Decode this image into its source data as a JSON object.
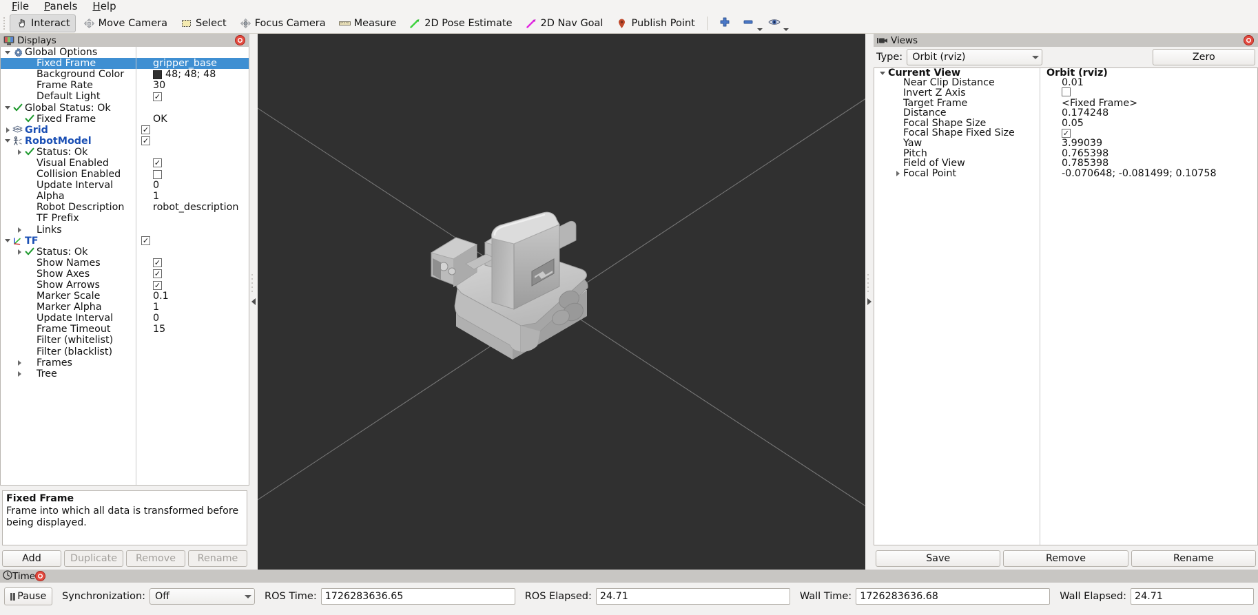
{
  "menubar": {
    "items": [
      "File",
      "Panels",
      "Help"
    ]
  },
  "toolbar": {
    "tools": [
      {
        "label": "Interact",
        "icon": "hand-cursor-icon",
        "checked": true
      },
      {
        "label": "Move Camera",
        "icon": "move-camera-icon",
        "checked": false
      },
      {
        "label": "Select",
        "icon": "select-rectangle-icon",
        "checked": false
      },
      {
        "label": "Focus Camera",
        "icon": "focus-camera-icon",
        "checked": false
      },
      {
        "label": "Measure",
        "icon": "ruler-icon",
        "checked": false
      },
      {
        "label": "2D Pose Estimate",
        "icon": "green-arrow-icon",
        "checked": false
      },
      {
        "label": "2D Nav Goal",
        "icon": "magenta-arrow-icon",
        "checked": false
      },
      {
        "label": "Publish Point",
        "icon": "map-pin-icon",
        "checked": false
      }
    ],
    "icon_buttons": [
      {
        "name": "add-tool-button",
        "icon": "plus-icon"
      },
      {
        "name": "remove-tool-button",
        "icon": "minus-icon"
      },
      {
        "name": "visibility-button",
        "icon": "eye-icon"
      }
    ]
  },
  "displays": {
    "title": "Displays",
    "close_icon": "close-icon",
    "panel_icon": "display-monitor-icon",
    "rows": [
      {
        "indent": 0,
        "arrow": "down",
        "icon": "gear-icon",
        "label": "Global Options",
        "style": "plain",
        "value_type": "none",
        "value": ""
      },
      {
        "indent": 1,
        "arrow": "none",
        "icon": "none",
        "label": "Fixed Frame",
        "style": "plain",
        "value_type": "text",
        "value": "gripper_base",
        "selected": true
      },
      {
        "indent": 1,
        "arrow": "none",
        "icon": "none",
        "label": "Background Color",
        "style": "plain",
        "value_type": "color",
        "value": "48; 48; 48",
        "color": "#303030"
      },
      {
        "indent": 1,
        "arrow": "none",
        "icon": "none",
        "label": "Frame Rate",
        "style": "plain",
        "value_type": "text",
        "value": "30"
      },
      {
        "indent": 1,
        "arrow": "none",
        "icon": "none",
        "label": "Default Light",
        "style": "plain",
        "value_type": "checked",
        "value": ""
      },
      {
        "indent": 0,
        "arrow": "down",
        "icon": "check-icon",
        "label": "Global Status: Ok",
        "style": "plain",
        "value_type": "none",
        "value": ""
      },
      {
        "indent": 1,
        "arrow": "none",
        "icon": "check-icon",
        "label": "Fixed Frame",
        "style": "plain",
        "value_type": "text",
        "value": "OK"
      },
      {
        "indent": 0,
        "arrow": "right",
        "icon": "grid-icon",
        "label": "Grid",
        "style": "blue",
        "value_type": "checked",
        "value": ""
      },
      {
        "indent": 0,
        "arrow": "down",
        "icon": "robot-icon",
        "label": "RobotModel",
        "style": "blue",
        "value_type": "checked",
        "value": ""
      },
      {
        "indent": 1,
        "arrow": "right",
        "icon": "check-icon",
        "label": "Status: Ok",
        "style": "plain",
        "value_type": "none",
        "value": ""
      },
      {
        "indent": 1,
        "arrow": "none",
        "icon": "none",
        "label": "Visual Enabled",
        "style": "plain",
        "value_type": "checked",
        "value": ""
      },
      {
        "indent": 1,
        "arrow": "none",
        "icon": "none",
        "label": "Collision Enabled",
        "style": "plain",
        "value_type": "unchecked",
        "value": ""
      },
      {
        "indent": 1,
        "arrow": "none",
        "icon": "none",
        "label": "Update Interval",
        "style": "plain",
        "value_type": "text",
        "value": "0"
      },
      {
        "indent": 1,
        "arrow": "none",
        "icon": "none",
        "label": "Alpha",
        "style": "plain",
        "value_type": "text",
        "value": "1"
      },
      {
        "indent": 1,
        "arrow": "none",
        "icon": "none",
        "label": "Robot Description",
        "style": "plain",
        "value_type": "text",
        "value": "robot_description"
      },
      {
        "indent": 1,
        "arrow": "none",
        "icon": "none",
        "label": "TF Prefix",
        "style": "plain",
        "value_type": "text",
        "value": ""
      },
      {
        "indent": 1,
        "arrow": "right",
        "icon": "none",
        "label": "Links",
        "style": "plain",
        "value_type": "none",
        "value": ""
      },
      {
        "indent": 0,
        "arrow": "down",
        "icon": "tf-axes-icon",
        "label": "TF",
        "style": "blue",
        "value_type": "checked",
        "value": ""
      },
      {
        "indent": 1,
        "arrow": "right",
        "icon": "check-icon",
        "label": "Status: Ok",
        "style": "plain",
        "value_type": "none",
        "value": ""
      },
      {
        "indent": 1,
        "arrow": "none",
        "icon": "none",
        "label": "Show Names",
        "style": "plain",
        "value_type": "checked",
        "value": ""
      },
      {
        "indent": 1,
        "arrow": "none",
        "icon": "none",
        "label": "Show Axes",
        "style": "plain",
        "value_type": "checked",
        "value": ""
      },
      {
        "indent": 1,
        "arrow": "none",
        "icon": "none",
        "label": "Show Arrows",
        "style": "plain",
        "value_type": "checked",
        "value": ""
      },
      {
        "indent": 1,
        "arrow": "none",
        "icon": "none",
        "label": "Marker Scale",
        "style": "plain",
        "value_type": "text",
        "value": "0.1"
      },
      {
        "indent": 1,
        "arrow": "none",
        "icon": "none",
        "label": "Marker Alpha",
        "style": "plain",
        "value_type": "text",
        "value": "1"
      },
      {
        "indent": 1,
        "arrow": "none",
        "icon": "none",
        "label": "Update Interval",
        "style": "plain",
        "value_type": "text",
        "value": "0"
      },
      {
        "indent": 1,
        "arrow": "none",
        "icon": "none",
        "label": "Frame Timeout",
        "style": "plain",
        "value_type": "text",
        "value": "15"
      },
      {
        "indent": 1,
        "arrow": "none",
        "icon": "none",
        "label": "Filter (whitelist)",
        "style": "plain",
        "value_type": "text",
        "value": ""
      },
      {
        "indent": 1,
        "arrow": "none",
        "icon": "none",
        "label": "Filter (blacklist)",
        "style": "plain",
        "value_type": "text",
        "value": ""
      },
      {
        "indent": 1,
        "arrow": "right",
        "icon": "none",
        "label": "Frames",
        "style": "plain",
        "value_type": "none",
        "value": ""
      },
      {
        "indent": 1,
        "arrow": "right",
        "icon": "none",
        "label": "Tree",
        "style": "plain",
        "value_type": "none",
        "value": ""
      }
    ],
    "description": {
      "title": "Fixed Frame",
      "text": "Frame into which all data is transformed before being displayed."
    },
    "buttons": [
      {
        "label": "Add",
        "disabled": false
      },
      {
        "label": "Duplicate",
        "disabled": true
      },
      {
        "label": "Remove",
        "disabled": true
      },
      {
        "label": "Rename",
        "disabled": true
      }
    ]
  },
  "views": {
    "title": "Views",
    "panel_icon": "camera-icon",
    "close_icon": "close-icon",
    "type_label": "Type:",
    "type_value": "Orbit (rviz)",
    "zero_label": "Zero",
    "rows": [
      {
        "indent": 0,
        "arrow": "down",
        "label": "Current View",
        "value": "Orbit (rviz)",
        "bold": true,
        "value_type": "text"
      },
      {
        "indent": 1,
        "arrow": "none",
        "label": "Near Clip Distance",
        "value": "0.01",
        "bold": false,
        "value_type": "text"
      },
      {
        "indent": 1,
        "arrow": "none",
        "label": "Invert Z Axis",
        "value": "",
        "bold": false,
        "value_type": "unchecked"
      },
      {
        "indent": 1,
        "arrow": "none",
        "label": "Target Frame",
        "value": "<Fixed Frame>",
        "bold": false,
        "value_type": "text"
      },
      {
        "indent": 1,
        "arrow": "none",
        "label": "Distance",
        "value": "0.174248",
        "bold": false,
        "value_type": "text"
      },
      {
        "indent": 1,
        "arrow": "none",
        "label": "Focal Shape Size",
        "value": "0.05",
        "bold": false,
        "value_type": "text"
      },
      {
        "indent": 1,
        "arrow": "none",
        "label": "Focal Shape Fixed Size",
        "value": "",
        "bold": false,
        "value_type": "checked"
      },
      {
        "indent": 1,
        "arrow": "none",
        "label": "Yaw",
        "value": "3.99039",
        "bold": false,
        "value_type": "text"
      },
      {
        "indent": 1,
        "arrow": "none",
        "label": "Pitch",
        "value": "0.765398",
        "bold": false,
        "value_type": "text"
      },
      {
        "indent": 1,
        "arrow": "none",
        "label": "Field of View",
        "value": "0.785398",
        "bold": false,
        "value_type": "text"
      },
      {
        "indent": 1,
        "arrow": "right",
        "label": "Focal Point",
        "value": "-0.070648; -0.081499; 0.10758",
        "bold": false,
        "value_type": "text"
      }
    ],
    "buttons": [
      {
        "label": "Save"
      },
      {
        "label": "Remove"
      },
      {
        "label": "Rename"
      }
    ]
  },
  "viewport": {
    "background_color": "#303030",
    "model_name": "gripper robot model"
  },
  "time": {
    "title": "Time",
    "panel_icon": "clock-icon",
    "pause_label": "Pause",
    "sync_label": "Synchronization:",
    "sync_value": "Off",
    "fields": [
      {
        "label": "ROS Time:",
        "value": "1726283636.65"
      },
      {
        "label": "ROS Elapsed:",
        "value": "24.71"
      },
      {
        "label": "Wall Time:",
        "value": "1726283636.68"
      },
      {
        "label": "Wall Elapsed:",
        "value": "24.71"
      }
    ]
  }
}
